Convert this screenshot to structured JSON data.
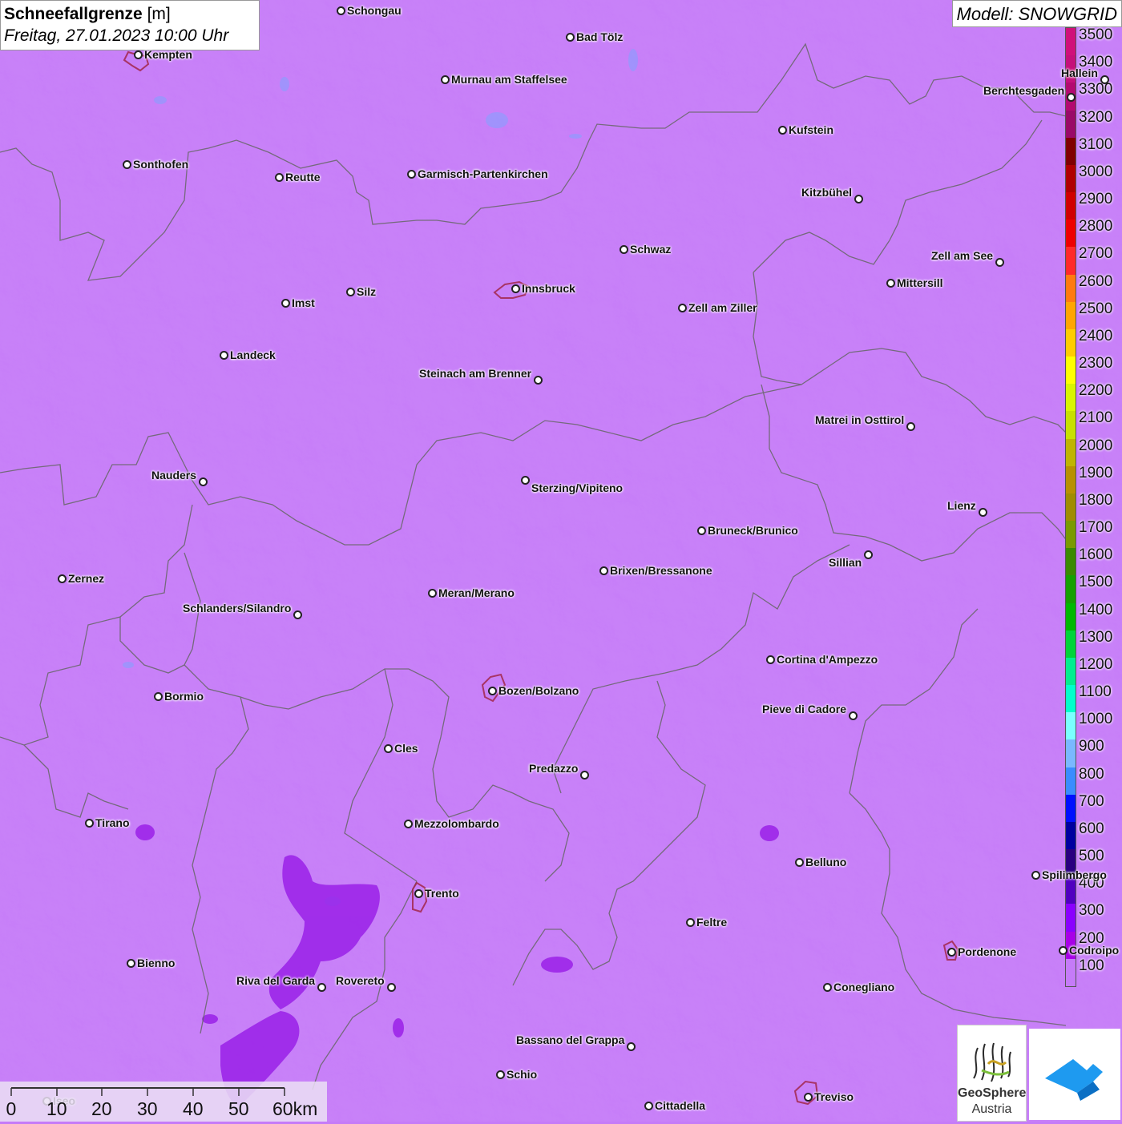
{
  "title": {
    "bold": "Schneefallgrenze",
    "unit": "[m]",
    "datetime": "Freitag, 27.01.2023 10:00 Uhr"
  },
  "model_label": "Modell: SNOWGRID",
  "legend": {
    "labels": [
      "3500",
      "3400",
      "3300",
      "3200",
      "3100",
      "3000",
      "2900",
      "2800",
      "2700",
      "2600",
      "2500",
      "2400",
      "2300",
      "2200",
      "2100",
      "2000",
      "1900",
      "1800",
      "1700",
      "1600",
      "1500",
      "1400",
      "1300",
      "1200",
      "1100",
      "1000",
      "900",
      "800",
      "700",
      "600",
      "500",
      "400",
      "300",
      "200",
      "100"
    ],
    "colors": [
      "#d0107a",
      "#c5107a",
      "#b30a70",
      "#9a0a68",
      "#800000",
      "#b00000",
      "#d00000",
      "#ee0000",
      "#ff2a2a",
      "#ff7a10",
      "#ffa500",
      "#ffcc00",
      "#ffff00",
      "#d9f500",
      "#c8e000",
      "#c0b400",
      "#b89000",
      "#a08c00",
      "#7a9a00",
      "#3a8a00",
      "#15a000",
      "#00b800",
      "#00d43a",
      "#00ee90",
      "#00ffcc",
      "#7affff",
      "#7ab8ff",
      "#3a8cff",
      "#0010ff",
      "#0000a0",
      "#2a0080",
      "#5000c0",
      "#8a00ff",
      "#a800e8",
      "#c57bf8"
    ]
  },
  "places": [
    {
      "name": "Schongau"
    },
    {
      "name": "Bad Tölz"
    },
    {
      "name": "Kempten"
    },
    {
      "name": "Murnau am Staffelsee"
    },
    {
      "name": "Hallein"
    },
    {
      "name": "Berchtesgaden"
    },
    {
      "name": "Kufstein"
    },
    {
      "name": "Sonthofen"
    },
    {
      "name": "Reutte"
    },
    {
      "name": "Garmisch-Partenkirchen"
    },
    {
      "name": "Kitzbühel"
    },
    {
      "name": "Schwaz"
    },
    {
      "name": "Zell am See"
    },
    {
      "name": "Mittersill"
    },
    {
      "name": "Innsbruck"
    },
    {
      "name": "Silz"
    },
    {
      "name": "Imst"
    },
    {
      "name": "Zell am Ziller"
    },
    {
      "name": "Landeck"
    },
    {
      "name": "Steinach am Brenner"
    },
    {
      "name": "Matrei in Osttirol"
    },
    {
      "name": "Nauders"
    },
    {
      "name": "Sterzing/Vipiteno"
    },
    {
      "name": "Lienz"
    },
    {
      "name": "Bruneck/Brunico"
    },
    {
      "name": "Sillian"
    },
    {
      "name": "Zernez"
    },
    {
      "name": "Brixen/Bressanone"
    },
    {
      "name": "Meran/Merano"
    },
    {
      "name": "Schlanders/Silandro"
    },
    {
      "name": "Cortina d'Ampezzo"
    },
    {
      "name": "Bormio"
    },
    {
      "name": "Bozen/Bolzano"
    },
    {
      "name": "Pieve di Cadore"
    },
    {
      "name": "Cles"
    },
    {
      "name": "Predazzo"
    },
    {
      "name": "Tirano"
    },
    {
      "name": "Mezzolombardo"
    },
    {
      "name": "Belluno"
    },
    {
      "name": "Spilimbergo"
    },
    {
      "name": "Trento"
    },
    {
      "name": "Feltre"
    },
    {
      "name": "Pordenone"
    },
    {
      "name": "Codroipo"
    },
    {
      "name": "Bienno"
    },
    {
      "name": "Riva del Garda"
    },
    {
      "name": "Rovereto"
    },
    {
      "name": "Conegliano"
    },
    {
      "name": "Bassano del Grappa"
    },
    {
      "name": "Schio"
    },
    {
      "name": "Iseo"
    },
    {
      "name": "Treviso"
    },
    {
      "name": "Cittadella"
    }
  ],
  "scale": {
    "labels": [
      "0",
      "10",
      "20",
      "30",
      "40",
      "50",
      "60km"
    ]
  },
  "logos": {
    "geosphere_line1": "GeoSphere",
    "geosphere_line2": "Austria"
  }
}
